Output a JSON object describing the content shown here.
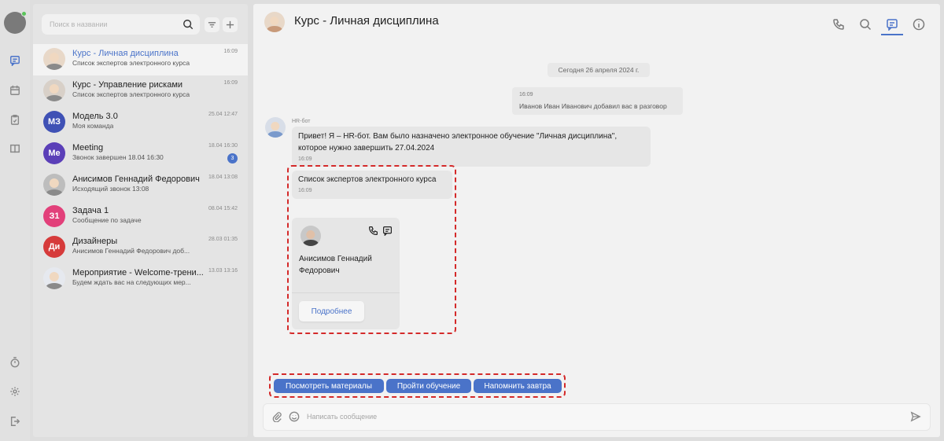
{
  "rail": {
    "icons": [
      "user-avatar",
      "chat-icon",
      "calendar-icon",
      "clipboard-icon",
      "book-icon",
      "timer-icon",
      "gear-icon",
      "logout-icon"
    ]
  },
  "search": {
    "placeholder": "Поиск в названии"
  },
  "chats": [
    {
      "name": "Курс - Личная дисциплина",
      "subtitle": "Список экспертов электронного курса",
      "time": "16:09",
      "avatar": "",
      "color": "#e8d8c8",
      "active": true
    },
    {
      "name": "Курс - Управление рисками",
      "subtitle": "Список экспертов электронного курса",
      "time": "16:09",
      "avatar": "",
      "color": "#d8d0c8"
    },
    {
      "name": "Модель 3.0",
      "subtitle": "Моя команда",
      "time": "25.04 12:47",
      "avatar": "МЗ",
      "color": "#3f51b5"
    },
    {
      "name": "Meeting",
      "subtitle": "Звонок завершен 18.04 16:30",
      "time": "18.04 16:30",
      "avatar": "Me",
      "color": "#5b3fb8",
      "badge": "3"
    },
    {
      "name": "Анисимов Геннадий Федорович",
      "subtitle": "Исходящий звонок 13:08",
      "time": "18.04 13:08",
      "avatar": "",
      "color": "#bdbdbd"
    },
    {
      "name": "Задача 1",
      "subtitle": "Сообщение по задаче",
      "time": "08.04 15:42",
      "avatar": "З1",
      "color": "#e2407a"
    },
    {
      "name": "Дизайнеры",
      "subtitle": "Анисимов Геннадий Федорович доб...",
      "time": "28.03 01:35",
      "avatar": "Ди",
      "color": "#d63b3b"
    },
    {
      "name": "Мероприятие - Welcome-трени...",
      "subtitle": "Будем ждать вас на следующих мер...",
      "time": "13.03 13:16",
      "avatar": "",
      "color": "#e6e9ef"
    }
  ],
  "header": {
    "title": "Курс - Личная дисциплина"
  },
  "messages": {
    "date": "Сегодня 26 апреля 2024 г.",
    "system": {
      "time": "16:09",
      "text": "Иванов Иван Иванович добавил вас в разговор"
    },
    "bot_name": "HR-бот",
    "bot_msg1_line1": "Привет! Я – HR-бот. Вам было назначено электронное обучение \"Личная дисциплина\",",
    "bot_msg1_line2": "которое нужно завершить 27.04.2024",
    "bot_msg1_time": "16:09",
    "bot_msg2": "Список экспертов электронного курса",
    "bot_msg2_time": "16:09",
    "card": {
      "name_line1": "Анисимов Геннадий",
      "name_line2": "Федорович",
      "button": "Подробнее"
    }
  },
  "quick_replies": [
    "Посмотреть материалы",
    "Пройти обучение",
    "Напомнить завтра"
  ],
  "composer": {
    "placeholder": "Написать сообщение"
  },
  "colors": {
    "accent": "#4a73c9",
    "highlight": "#d42a2a"
  }
}
